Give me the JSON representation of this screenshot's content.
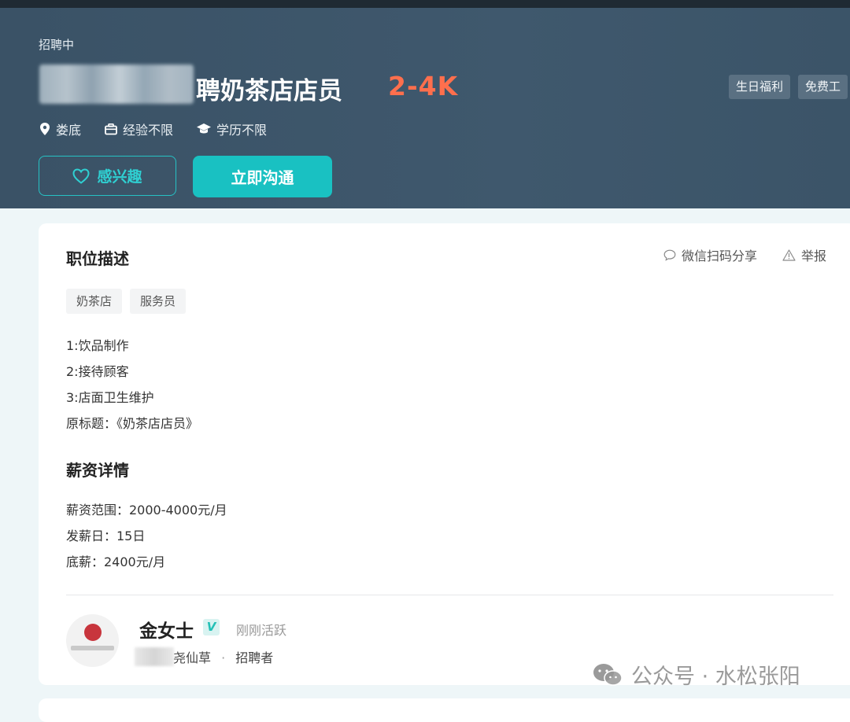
{
  "header": {
    "status": "招聘中",
    "job_title": "聘奶茶店店员",
    "salary": "2-4K",
    "welfare_tags": [
      "生日福利",
      "免费工"
    ],
    "meta": {
      "location": "娄底",
      "experience": "经验不限",
      "education": "学历不限"
    },
    "interest_button": "感兴趣",
    "chat_button": "立即沟通"
  },
  "description": {
    "title": "职位描述",
    "share_label": "微信扫码分享",
    "report_label": "举报",
    "tags": [
      "奶茶店",
      "服务员"
    ],
    "lines": [
      "1:饮品制作",
      "2:接待顾客",
      "3:店面卫生维护",
      "原标题：《奶茶店店员》"
    ]
  },
  "salary_details": {
    "title": "薪资详情",
    "lines": [
      "薪资范围：2000-4000元/月",
      "发薪日：15日",
      "底薪：2400元/月"
    ]
  },
  "recruiter": {
    "name": "金女士",
    "verified_mark": "V",
    "active_status": "刚刚活跃",
    "company_suffix": "尧仙草",
    "separator": "·",
    "role": "招聘者"
  },
  "watermark": {
    "text": "公众号 · 水松张阳"
  },
  "colors": {
    "header_bg": "#3f586d",
    "accent": "#19c1c2",
    "salary": "#ff6f4d"
  }
}
